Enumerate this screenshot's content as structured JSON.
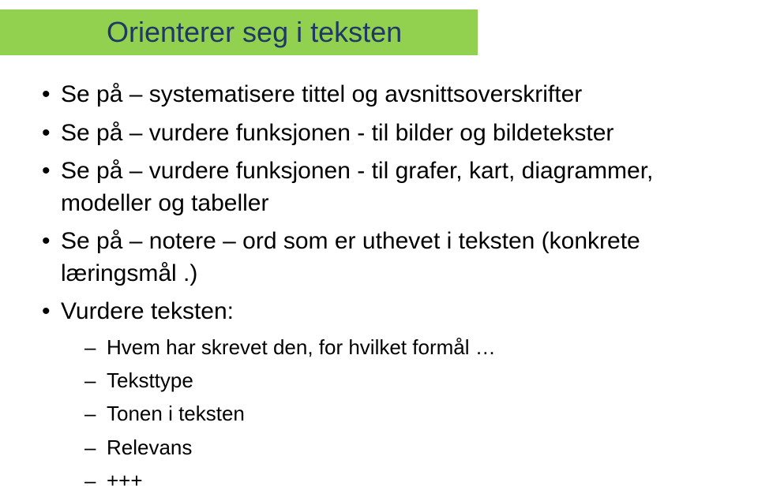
{
  "title": "Orienterer seg i teksten",
  "bullets": [
    {
      "text": "Se på – systematisere tittel og avsnittsoverskrifter"
    },
    {
      "text": "Se på – vurdere funksjonen - til bilder og bildetekster"
    },
    {
      "text": "Se på – vurdere funksjonen - til grafer, kart, diagrammer, modeller og tabeller"
    },
    {
      "text": "Se på – notere – ord som er uthevet i teksten (konkrete læringsmål .)"
    },
    {
      "text": "Vurdere teksten:",
      "sub": [
        "Hvem har skrevet den, for hvilket formål …",
        "Teksttype",
        "Tonen i teksten",
        "Relevans",
        "+++"
      ]
    }
  ]
}
